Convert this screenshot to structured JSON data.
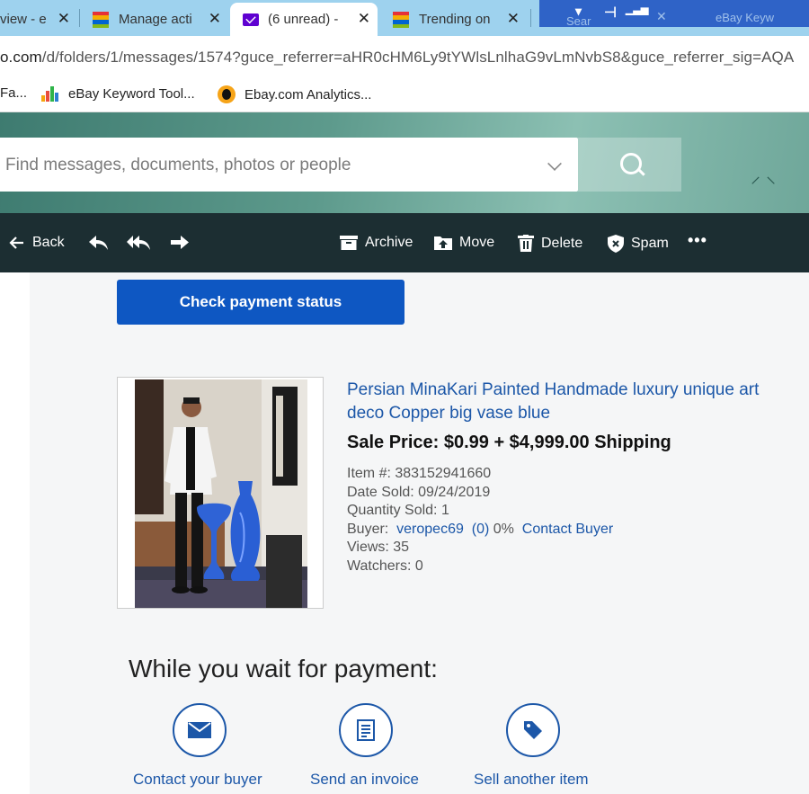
{
  "browser": {
    "tabs": [
      {
        "label": "view - e"
      },
      {
        "label": "Manage acti"
      },
      {
        "label": "(6 unread) -"
      },
      {
        "label": "Trending on"
      },
      {
        "label": "Sear"
      },
      {
        "label": "eBay Keyw"
      }
    ],
    "url_host": "o.com",
    "url_path": "/d/folders/1/messages/1574?guce_referrer=aHR0cHM6Ly9tYWlsLnlhaG9vLmNvbS8&guce_referrer_sig=AQA",
    "bookmarks": [
      {
        "label": "Fa..."
      },
      {
        "label": "eBay Keyword Tool..."
      },
      {
        "label": "Ebay.com Analytics..."
      }
    ]
  },
  "mail": {
    "search_placeholder": "Find messages, documents, photos or people",
    "toolbar": {
      "back": "Back",
      "archive": "Archive",
      "move": "Move",
      "delete": "Delete",
      "spam": "Spam",
      "more": "•••"
    }
  },
  "message": {
    "pay_button": "Check payment status",
    "item_title": "Persian MinaKari Painted Handmade luxury unique art deco Copper big vase blue",
    "sale_price": "Sale Price: $0.99 + $4,999.00 Shipping",
    "item_number": "Item #: 383152941660",
    "date_sold": "Date Sold: 09/24/2019",
    "quantity_sold": "Quantity Sold: 1",
    "buyer_label": "Buyer:",
    "buyer_name": "veropec69",
    "buyer_feedback": "(0)",
    "buyer_pct": "0%",
    "contact_buyer": "Contact Buyer",
    "views": "Views: 35",
    "watchers": "Watchers: 0",
    "wait_heading": "While you wait for payment:",
    "actions": [
      {
        "label": "Contact your buyer",
        "icon": "envelope-icon"
      },
      {
        "label": "Send an invoice",
        "icon": "invoice-icon"
      },
      {
        "label": "Sell another item",
        "icon": "tag-icon"
      }
    ]
  },
  "colors": {
    "tabstrip": "#9ed2ee",
    "toolbar": "#1c2e32",
    "button_blue": "#0e57c2",
    "link_blue": "#1c57a8"
  }
}
